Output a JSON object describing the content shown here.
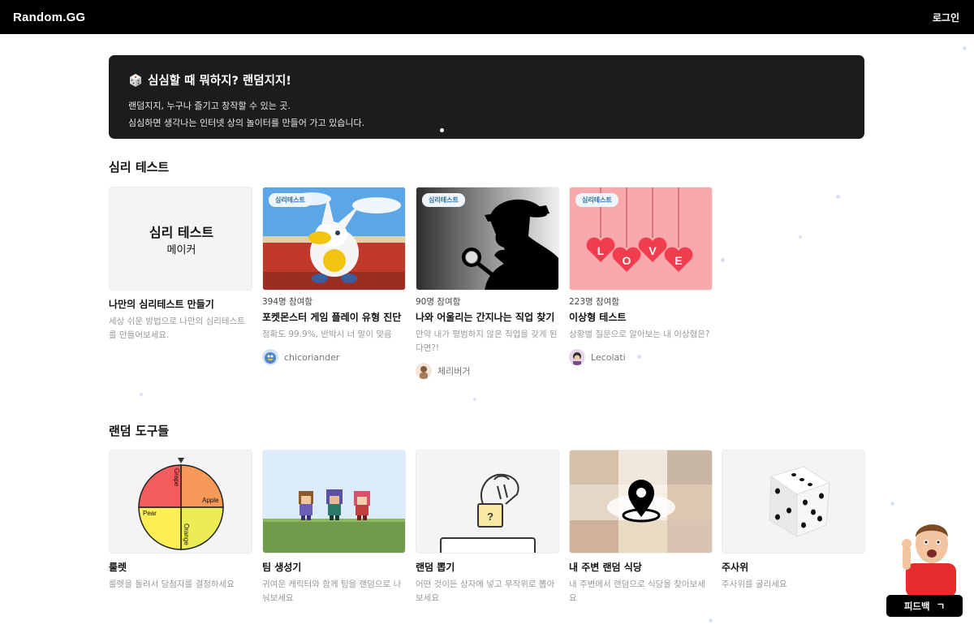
{
  "header": {
    "logo": "Random.GG",
    "login": "로그인"
  },
  "banner": {
    "title": "심심할 때 뭐하지? 랜덤지지!",
    "line1": "랜덤지지, 누구나 즐기고 창작할 수 있는 곳.",
    "line2": "심심하면 생각나는 인터넷 상의 놀이터를 만들어 가고 있습니다."
  },
  "psych": {
    "title": "심리 테스트",
    "maker": {
      "thumb_title": "심리 테스트",
      "thumb_sub": "메이커",
      "title": "나만의 심리테스트 만들기",
      "desc": "세상 쉬운 방법으로 나만의 심리테스트를 만들어보세요."
    },
    "cards": [
      {
        "tag": "심리테스트",
        "count": "394명 참여함",
        "title": "포켓몬스터 게임 플레이 유형 진단",
        "desc": "정확도 99.9%, 반박시 너 말이 맞음",
        "author": "chicoriander"
      },
      {
        "tag": "심리테스트",
        "count": "90명 참여함",
        "title": "나와 어울리는 간지나는 직업 찾기",
        "desc": "만약 내가 평범하지 않은 직업을 갖게 된다면?!",
        "author": "체리버거"
      },
      {
        "tag": "심리테스트",
        "count": "223명 참여함",
        "title": "이상형 테스트",
        "desc": "상황별 질문으로 알아보는 내 이상형은?",
        "author": "Lecolati",
        "love": [
          "L",
          "O",
          "V",
          "E"
        ]
      }
    ]
  },
  "tools": {
    "title": "랜덤 도구들",
    "roulette_labels": [
      "Grape",
      "Apple",
      "Pear",
      "Orange"
    ],
    "box_mark": "?",
    "cards": [
      {
        "title": "룰렛",
        "desc": "룰렛을 돌려서 당첨자를 결정하세요"
      },
      {
        "title": "팀 생성기",
        "desc": "귀여운 캐릭터와 함께 팀을 랜덤으로 나눠보세요"
      },
      {
        "title": "랜덤 뽑기",
        "desc": "어떤 것이든 상자에 넣고 무작위로 뽑아보세요"
      },
      {
        "title": "내 주변 랜덤 식당",
        "desc": "내 주변에서 랜덤으로 식당을 찾아보세요"
      },
      {
        "title": "주사위",
        "desc": "주사위를 굴리세요"
      }
    ]
  },
  "feedback": {
    "label": "피드백",
    "icon": "ㄱ"
  }
}
